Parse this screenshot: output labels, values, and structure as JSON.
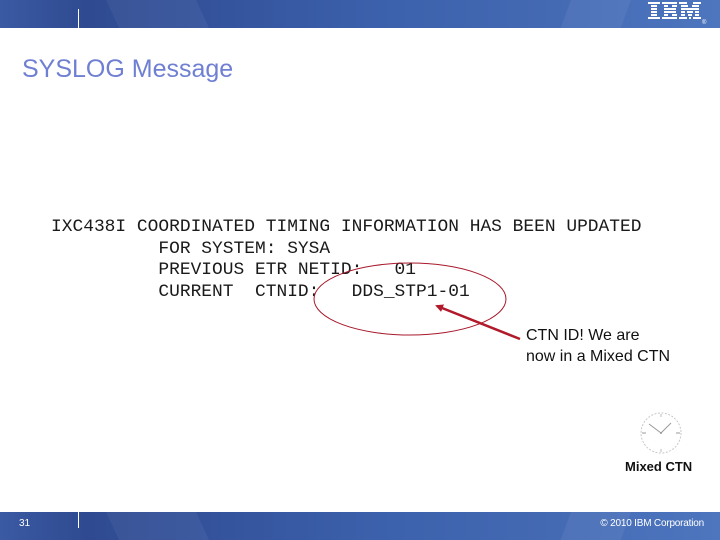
{
  "header": {
    "logo": "IBM",
    "logo_icon": "ibm-logo-icon"
  },
  "slide": {
    "title": "SYSLOG Message",
    "syslog_lines": [
      "IXC438I COORDINATED TIMING INFORMATION HAS BEEN UPDATED",
      "          FOR SYSTEM: SYSA",
      "          PREVIOUS ETR NETID:   01",
      "          CURRENT  CTNID:   DDS_STP1-01"
    ],
    "callout": {
      "line1": "CTN ID!  We are",
      "line2": "now in a Mixed CTN"
    },
    "clock": {
      "icon": "clock-icon",
      "label": "Mixed CTN"
    },
    "annotation_color": "#b01a2a"
  },
  "footer": {
    "page_number": "31",
    "copyright": "© 2010 IBM Corporation"
  },
  "colors": {
    "title": "#6f7fd2",
    "band": "#3d62ad"
  }
}
